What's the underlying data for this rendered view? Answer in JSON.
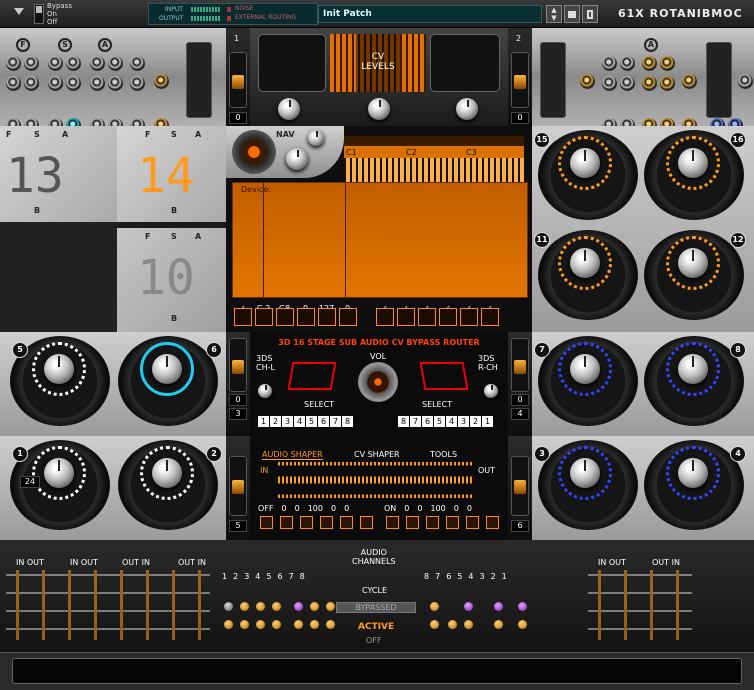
{
  "topbar": {
    "bypass_options": [
      "Bypass",
      "On",
      "Off"
    ],
    "input_label": "INPUT",
    "output_label": "OUTPUT",
    "noise_label": "NOISE",
    "ext_routing_label": "EXTERNAL ROUTING",
    "patch_name": "Init Patch",
    "device_name": "61X ROTANIBMOC"
  },
  "colors": {
    "accent": "#ff8a1a",
    "blue": "#3344ff",
    "cyan": "#22ccee"
  },
  "top_section": {
    "sector_labels": [
      "F",
      "S",
      "A"
    ],
    "channel_left": "1",
    "channel_right": "2",
    "slider_value_left": "0",
    "slider_value_right": "0",
    "cv_levels_label": "CV\nLEVELS"
  },
  "modules": {
    "m13": {
      "num": "13",
      "labels": [
        "F",
        "S",
        "A",
        "B"
      ]
    },
    "m14": {
      "num": "14",
      "labels": [
        "F",
        "S",
        "A",
        "B"
      ]
    },
    "m10": {
      "num": "10",
      "labels": [
        "F",
        "S",
        "A",
        "B"
      ]
    }
  },
  "nav": {
    "label": "NAV"
  },
  "display": {
    "octaves": [
      "C1",
      "C2",
      "C3"
    ],
    "device_label": "Device:",
    "param_values": [
      "✓",
      "C-2",
      "G8",
      "0",
      "127",
      "0",
      "✓",
      "✓",
      "✓",
      "✓",
      "✓",
      "✓"
    ]
  },
  "knob_badges": {
    "right_top": [
      "15",
      "16",
      "11",
      "12"
    ],
    "mid_left": [
      "5",
      "6"
    ],
    "mid_right": [
      "7",
      "8"
    ],
    "bot_left": [
      "1",
      "2"
    ],
    "bot_right": [
      "3",
      "4"
    ],
    "knob1_value": "24"
  },
  "router": {
    "title": "3D 16 STAGE SUB AUDIO CV BYPASS ROUTER",
    "left_label": "3DS\nCH-L",
    "right_label": "3DS\nR-CH",
    "vol_label": "VOL",
    "select_left": "SELECT",
    "select_right": "SELECT",
    "left_numbers": [
      "1",
      "2",
      "3",
      "4",
      "5",
      "6",
      "7",
      "8"
    ],
    "right_numbers": [
      "8",
      "7",
      "6",
      "5",
      "4",
      "3",
      "2",
      "1"
    ],
    "slider_left": "0",
    "slider_left2": "3",
    "slider_right": "0",
    "slider_right2": "4",
    "slider_bottom_left": "5",
    "slider_bottom_right": "6"
  },
  "shaper": {
    "tabs": [
      "AUDIO SHAPER",
      "CV SHAPER",
      "TOOLS"
    ],
    "in_label": "IN",
    "out_label": "OUT",
    "left_values": [
      "OFF",
      "0",
      "0",
      "100",
      "0",
      "0"
    ],
    "right_values": [
      "ON",
      "0",
      "0",
      "100",
      "0",
      "0"
    ]
  },
  "bottom": {
    "io_labels": [
      "IN OUT",
      "IN OUT",
      "OUT IN",
      "OUT IN",
      "IN OUT",
      "OUT IN"
    ],
    "left_numbers": [
      "1",
      "2",
      "3",
      "4",
      "5",
      "6",
      "7",
      "8"
    ],
    "right_numbers": [
      "8",
      "7",
      "6",
      "5",
      "4",
      "3",
      "2",
      "1"
    ],
    "audio_channels": "AUDIO\nCHANNELS",
    "cycle": "CYCLE",
    "bypassed": "BYPASSED",
    "active": "ACTIVE",
    "off": "OFF"
  }
}
